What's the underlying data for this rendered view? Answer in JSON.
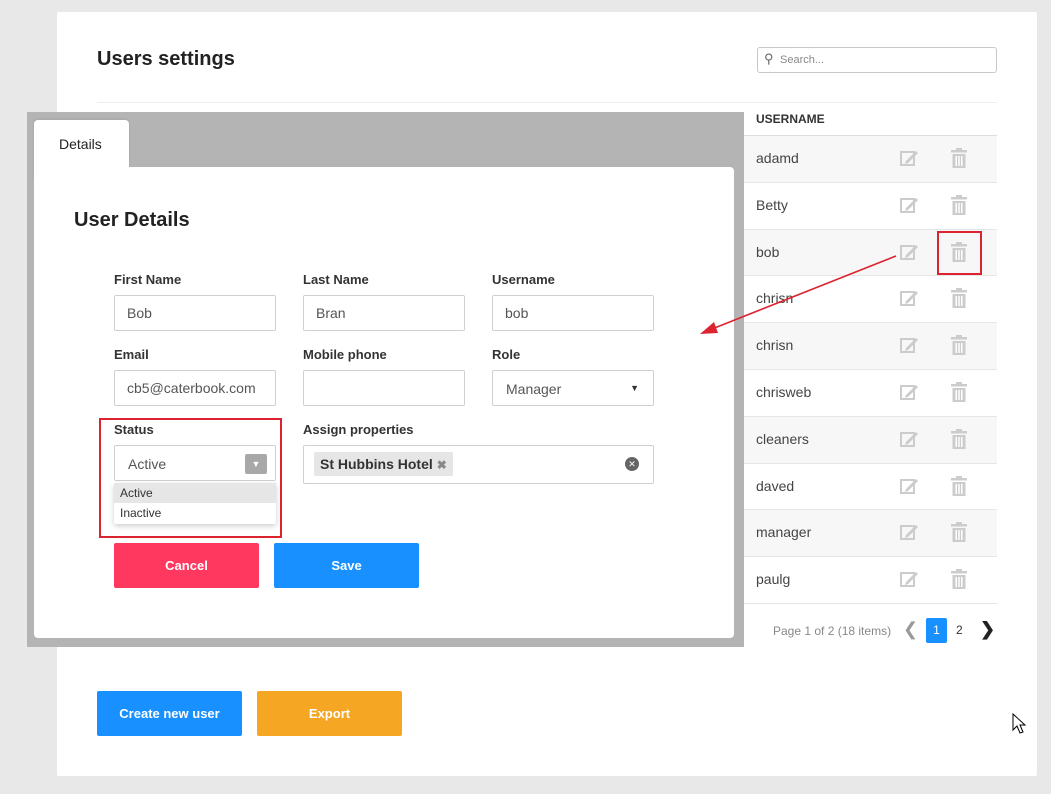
{
  "page": {
    "title": "Users settings",
    "search_placeholder": "Search..."
  },
  "table": {
    "column_username": "USERNAME",
    "rows": [
      {
        "username": "adamd"
      },
      {
        "username": "Betty"
      },
      {
        "username": "bob"
      },
      {
        "username": "chrisn"
      },
      {
        "username": "chrisn"
      },
      {
        "username": "chrisweb"
      },
      {
        "username": "cleaners"
      },
      {
        "username": "daved"
      },
      {
        "username": "manager"
      },
      {
        "username": "paulg"
      }
    ]
  },
  "pagination": {
    "info": "Page 1 of 2 (18 items)",
    "page1": "1",
    "page2": "2"
  },
  "footer_buttons": {
    "create": "Create new user",
    "export": "Export"
  },
  "modal": {
    "tab_label": "Details",
    "title": "User Details",
    "first_name": {
      "label": "First Name",
      "value": "Bob"
    },
    "last_name": {
      "label": "Last Name",
      "value": "Bran"
    },
    "username": {
      "label": "Username",
      "value": "bob"
    },
    "email": {
      "label": "Email",
      "value": "cb5@caterbook.com"
    },
    "mobile": {
      "label": "Mobile phone",
      "value": ""
    },
    "role": {
      "label": "Role",
      "value": "Manager"
    },
    "status": {
      "label": "Status",
      "value": "Active",
      "options": [
        "Active",
        "Inactive"
      ]
    },
    "assign": {
      "label": "Assign properties",
      "tags": [
        "St Hubbins Hotel"
      ]
    },
    "cancel": "Cancel",
    "save": "Save"
  },
  "colors": {
    "primary": "#1890ff",
    "danger": "#ff3860",
    "warning": "#f5a623",
    "annotation": "#dc2430"
  },
  "icons": [
    "search-icon",
    "edit-icon",
    "trash-icon",
    "chevron-left-icon",
    "chevron-right-icon",
    "caret-down-icon",
    "clear-icon",
    "tag-remove-icon",
    "mouse-cursor-icon"
  ]
}
